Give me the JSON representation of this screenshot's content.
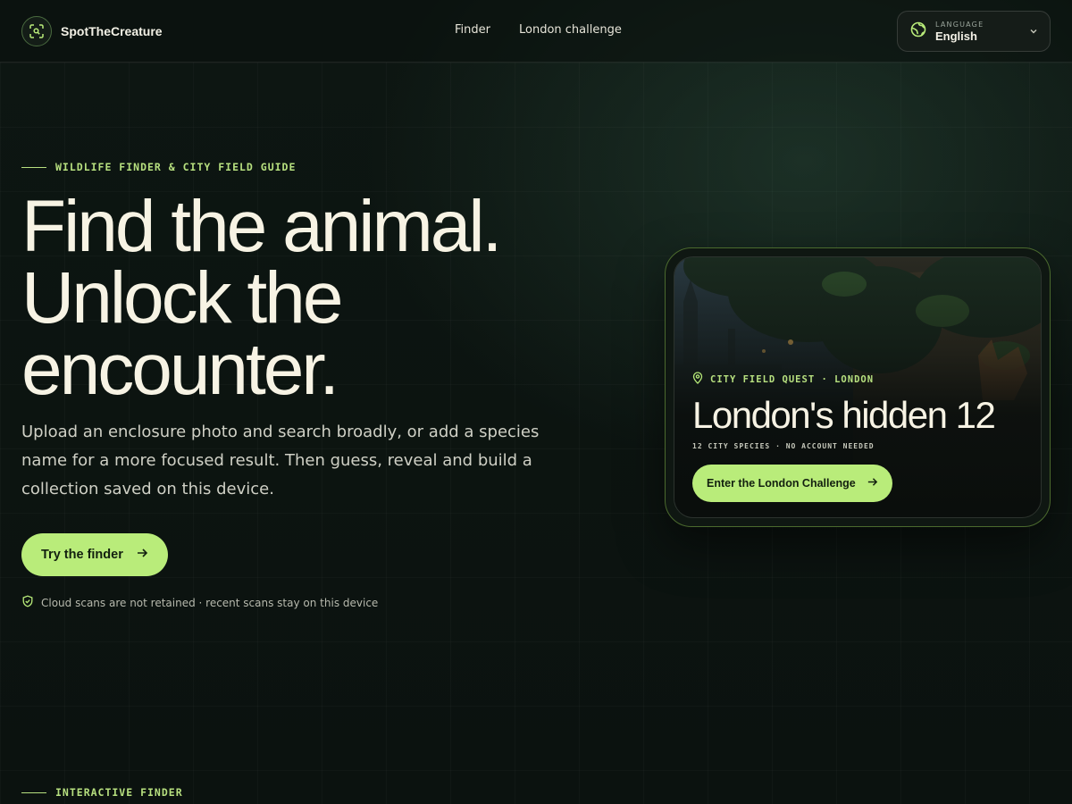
{
  "brand": {
    "name": "SpotTheCreature",
    "icon": "scan-icon"
  },
  "nav": {
    "items": [
      {
        "label": "Finder"
      },
      {
        "label": "London challenge"
      }
    ]
  },
  "language": {
    "label": "LANGUAGE",
    "value": "English",
    "icon": "globe-icon"
  },
  "hero": {
    "eyebrow": "WILDLIFE FINDER & CITY FIELD GUIDE",
    "title_lines": [
      "Find the animal.",
      "Unlock the",
      "encounter."
    ],
    "subtitle": "Upload an enclosure photo and search broadly, or add a species name for a more focused result. Then guess, reveal and build a collection saved on this device.",
    "cta_label": "Try the finder",
    "privacy_note": "Cloud scans are not retained · recent scans stay on this device"
  },
  "card": {
    "eyebrow": "CITY FIELD QUEST · LONDON",
    "title": "London's hidden 12",
    "meta": "12 CITY SPECIES · NO ACCOUNT NEEDED",
    "cta_label": "Enter the London Challenge"
  },
  "section": {
    "eyebrow": "INTERACTIVE FINDER"
  },
  "colors": {
    "accent": "#b9ec7a",
    "background": "#0c1410",
    "text": "#f3f1e6"
  }
}
